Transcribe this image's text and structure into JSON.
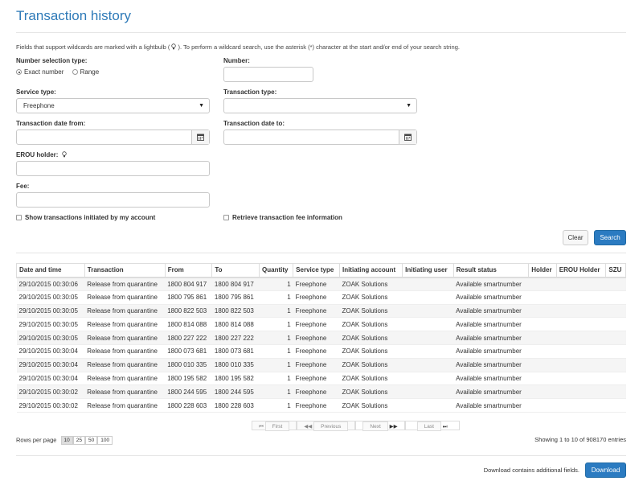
{
  "page": {
    "title": "Transaction history"
  },
  "info_text": "Fields that support wildcards are marked with a lightbulb (   ). To perform a wildcard search, use the asterisk (*) character at the start and/or end of your search string.",
  "info_text_pre": "Fields that support wildcards are marked with a lightbulb (",
  "info_text_post": "). To perform a wildcard search, use the asterisk (*) character at the start and/or end of your search string.",
  "form": {
    "number_selection_type": {
      "label": "Number selection type:",
      "options": [
        "Exact number",
        "Range"
      ],
      "selected": "Exact number"
    },
    "number": {
      "label": "Number:",
      "value": ""
    },
    "service_type": {
      "label": "Service type:",
      "value": "Freephone"
    },
    "transaction_type": {
      "label": "Transaction type:",
      "value": ""
    },
    "date_from": {
      "label": "Transaction date from:",
      "value": ""
    },
    "date_to": {
      "label": "Transaction date to:",
      "value": ""
    },
    "erou_holder": {
      "label": "EROU holder:",
      "value": ""
    },
    "fee": {
      "label": "Fee:",
      "value": ""
    },
    "show_own": {
      "label": "Show transactions initiated by my account",
      "checked": false
    },
    "retrieve_fee": {
      "label": "Retrieve transaction fee information",
      "checked": false
    },
    "clear_label": "Clear",
    "search_label": "Search"
  },
  "table": {
    "columns": [
      "Date and time",
      "Transaction",
      "From",
      "To",
      "Quantity",
      "Service type",
      "Initiating account",
      "Initiating user",
      "Result status",
      "Holder",
      "EROU Holder",
      "SZU"
    ],
    "rows": [
      [
        "29/10/2015 00:30:06",
        "Release from quarantine",
        "1800 804 917",
        "1800 804 917",
        "1",
        "Freephone",
        "ZOAK Solutions",
        "",
        "Available smartnumber",
        "",
        "",
        ""
      ],
      [
        "29/10/2015 00:30:05",
        "Release from quarantine",
        "1800 795 861",
        "1800 795 861",
        "1",
        "Freephone",
        "ZOAK Solutions",
        "",
        "Available smartnumber",
        "",
        "",
        ""
      ],
      [
        "29/10/2015 00:30:05",
        "Release from quarantine",
        "1800 822 503",
        "1800 822 503",
        "1",
        "Freephone",
        "ZOAK Solutions",
        "",
        "Available smartnumber",
        "",
        "",
        ""
      ],
      [
        "29/10/2015 00:30:05",
        "Release from quarantine",
        "1800 814 088",
        "1800 814 088",
        "1",
        "Freephone",
        "ZOAK Solutions",
        "",
        "Available smartnumber",
        "",
        "",
        ""
      ],
      [
        "29/10/2015 00:30:05",
        "Release from quarantine",
        "1800 227 222",
        "1800 227 222",
        "1",
        "Freephone",
        "ZOAK Solutions",
        "",
        "Available smartnumber",
        "",
        "",
        ""
      ],
      [
        "29/10/2015 00:30:04",
        "Release from quarantine",
        "1800 073 681",
        "1800 073 681",
        "1",
        "Freephone",
        "ZOAK Solutions",
        "",
        "Available smartnumber",
        "",
        "",
        ""
      ],
      [
        "29/10/2015 00:30:04",
        "Release from quarantine",
        "1800 010 335",
        "1800 010 335",
        "1",
        "Freephone",
        "ZOAK Solutions",
        "",
        "Available smartnumber",
        "",
        "",
        ""
      ],
      [
        "29/10/2015 00:30:04",
        "Release from quarantine",
        "1800 195 582",
        "1800 195 582",
        "1",
        "Freephone",
        "ZOAK Solutions",
        "",
        "Available smartnumber",
        "",
        "",
        ""
      ],
      [
        "29/10/2015 00:30:02",
        "Release from quarantine",
        "1800 244 595",
        "1800 244 595",
        "1",
        "Freephone",
        "ZOAK Solutions",
        "",
        "Available smartnumber",
        "",
        "",
        ""
      ],
      [
        "29/10/2015 00:30:02",
        "Release from quarantine",
        "1800 228 603",
        "1800 228 603",
        "1",
        "Freephone",
        "ZOAK Solutions",
        "",
        "Available smartnumber",
        "",
        "",
        ""
      ]
    ]
  },
  "pagination": {
    "first": "First",
    "previous": "Previous",
    "next": "Next",
    "last": "Last"
  },
  "rows_per_page": {
    "label": "Rows per page",
    "options": [
      "10",
      "25",
      "50",
      "100"
    ],
    "selected": "10"
  },
  "showing_text": "Showing 1 to 10 of 908170 entries",
  "footer": {
    "note": "Download contains additional fields.",
    "download_label": "Download"
  },
  "icons": {
    "lightbulb": "lightbulb-icon",
    "calendar": "calendar-icon",
    "dropdown": "caret-down-icon"
  },
  "colors": {
    "title": "#2e7ab8",
    "primary": "#2b7bc1"
  }
}
